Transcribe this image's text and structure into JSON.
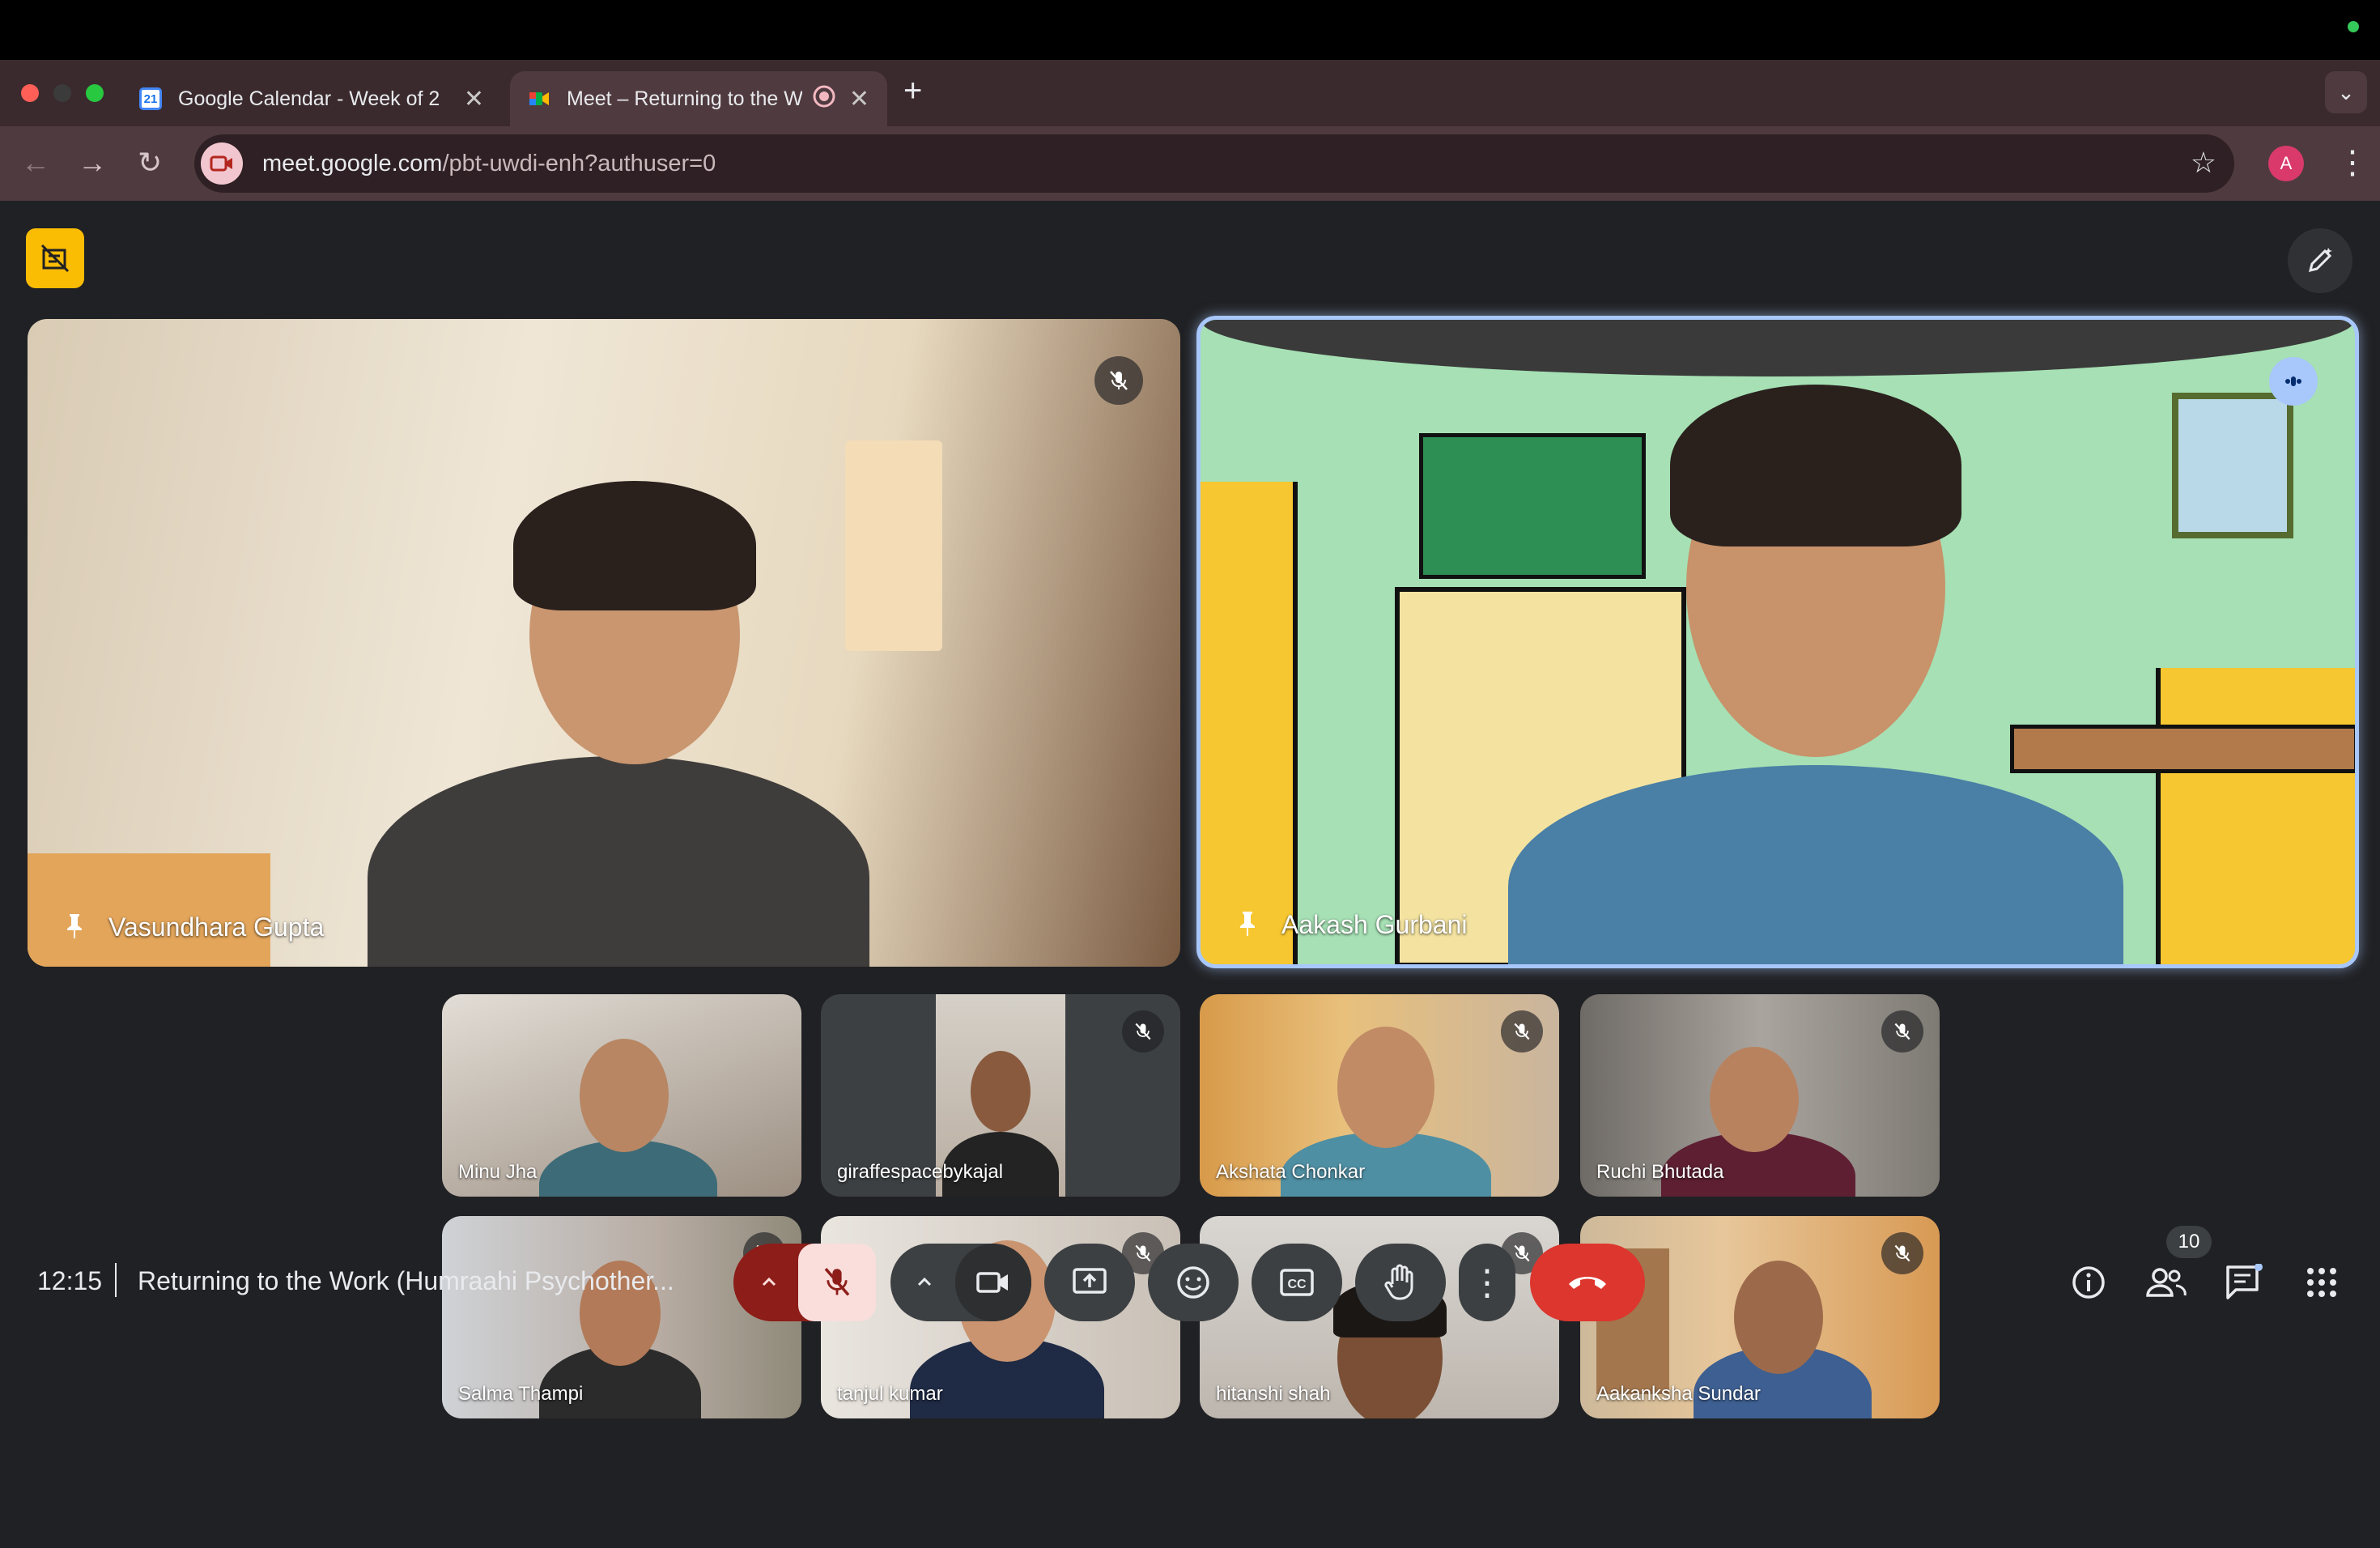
{
  "browser": {
    "tabs": [
      {
        "title": "Google Calendar - Week of 2",
        "favicon": "google-calendar-icon",
        "favicon_text": "21"
      },
      {
        "title": "Meet – Returning to the W",
        "favicon": "google-meet-icon",
        "recording": true
      }
    ],
    "url_host": "meet.google.com",
    "url_path": "/pbt-uwdi-enh?authuser=0",
    "profile_initial": "A"
  },
  "participants": {
    "main": [
      {
        "name": "Vasundhara Gupta",
        "muted": true,
        "pinned": true
      },
      {
        "name": "Aakash Gurbani",
        "muted": false,
        "pinned": true,
        "speaking": true
      }
    ],
    "grid": [
      {
        "name": "Minu Jha",
        "muted": false
      },
      {
        "name": "giraffespacebykajal",
        "muted": true
      },
      {
        "name": "Akshata Chonkar",
        "muted": true
      },
      {
        "name": "Ruchi Bhutada",
        "muted": true
      },
      {
        "name": "Salma Thampi",
        "muted": true
      },
      {
        "name": "tanjul kumar",
        "muted": true
      },
      {
        "name": "hitanshi shah",
        "muted": true
      },
      {
        "name": "Aakanksha Sundar",
        "muted": true
      }
    ]
  },
  "bottom_bar": {
    "time": "12:15",
    "meeting_title": "Returning to the Work (Humraahi Psychother...",
    "participant_count": "10"
  },
  "colors": {
    "accent": "#a8c7fa",
    "end_call": "#dc362e",
    "mic_off": "#f9dedc",
    "visual_effects": "#fbbc04"
  }
}
